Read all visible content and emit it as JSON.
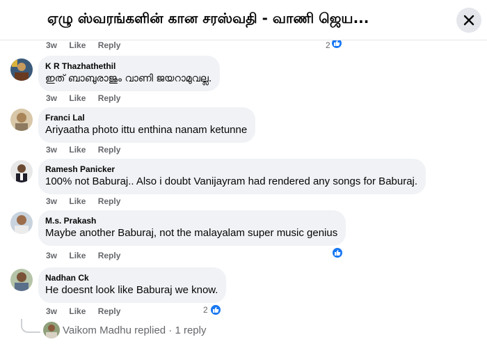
{
  "header": {
    "title": "ஏழு ஸ்வரங்களின் கான சரஸ்வதி - வாணி ஜெய..."
  },
  "top_partial": {
    "time": "3w",
    "like": "Like",
    "reply": "Reply",
    "reaction_count": "2"
  },
  "comments": [
    {
      "author": "K R Thazhathethil",
      "text": "ഇത് ബാബുരാജും വാണി ജയറാമുവല്ല.",
      "time": "3w",
      "like": "Like",
      "reply": "Reply",
      "reaction_count": ""
    },
    {
      "author": "Franci Lal",
      "text": "Ariyaatha photo ittu enthina nanam ketunne",
      "time": "3w",
      "like": "Like",
      "reply": "Reply",
      "reaction_count": ""
    },
    {
      "author": "Ramesh Panicker",
      "text": "100% not Baburaj.. Also i doubt Vanijayram had rendered any songs for Baburaj.",
      "time": "3w",
      "like": "Like",
      "reply": "Reply",
      "reaction_count": ""
    },
    {
      "author": "M.s. Prakash",
      "text": "Maybe another Baburaj, not the malayalam super music genius",
      "time": "3w",
      "like": "Like",
      "reply": "Reply",
      "reaction_count": ""
    },
    {
      "author": "Nadhan Ck",
      "text": "He doesnt look like Baburaj we know.",
      "time": "3w",
      "like": "Like",
      "reply": "Reply",
      "reaction_count": "2"
    }
  ],
  "reply_summary": {
    "text": "Vaikom Madhu replied · 1 reply"
  },
  "colors": {
    "accent": "#1877f2",
    "bubble": "#f0f2f5",
    "meta": "#65676b"
  }
}
